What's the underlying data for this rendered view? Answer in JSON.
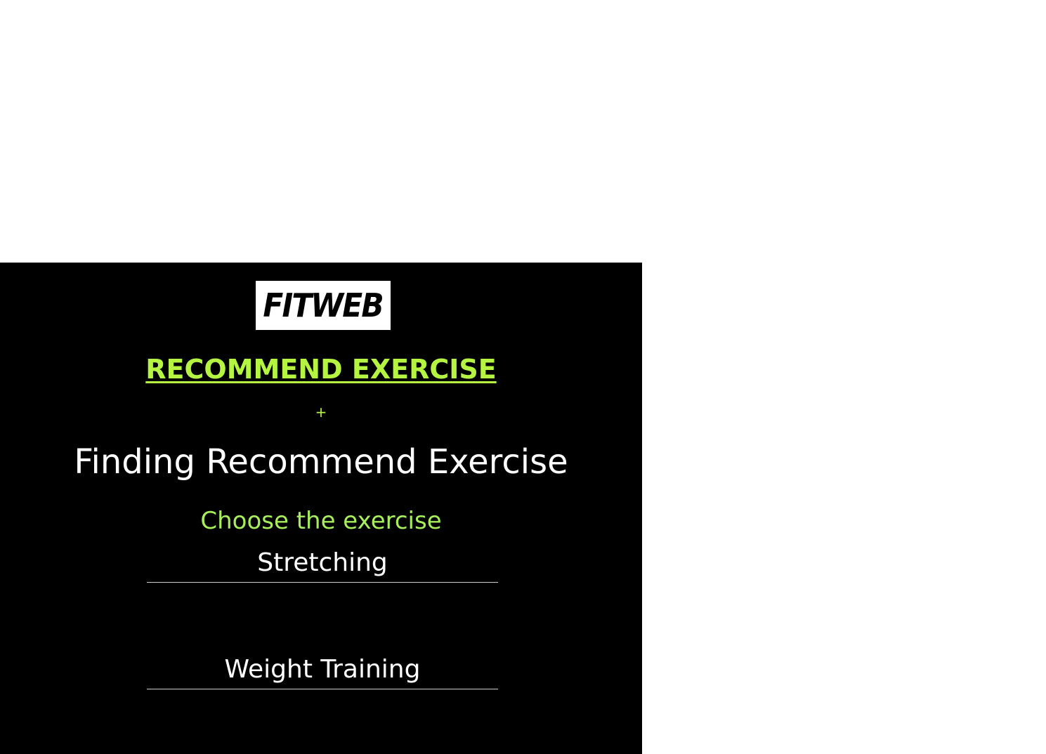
{
  "logo": {
    "text": "FITWEB"
  },
  "nav": {
    "recommend_link": "RECOMMEND EXERCISE",
    "plus": "+"
  },
  "main": {
    "title": "Finding Recommend Exercise",
    "choose_label": "Choose the exercise",
    "options": [
      {
        "label": "Stretching"
      },
      {
        "label": "Weight Training"
      }
    ]
  },
  "colors": {
    "accent": "#b5f542",
    "accent_soft": "#a7ef5a",
    "panel_bg": "#000000",
    "text": "#ffffff"
  }
}
